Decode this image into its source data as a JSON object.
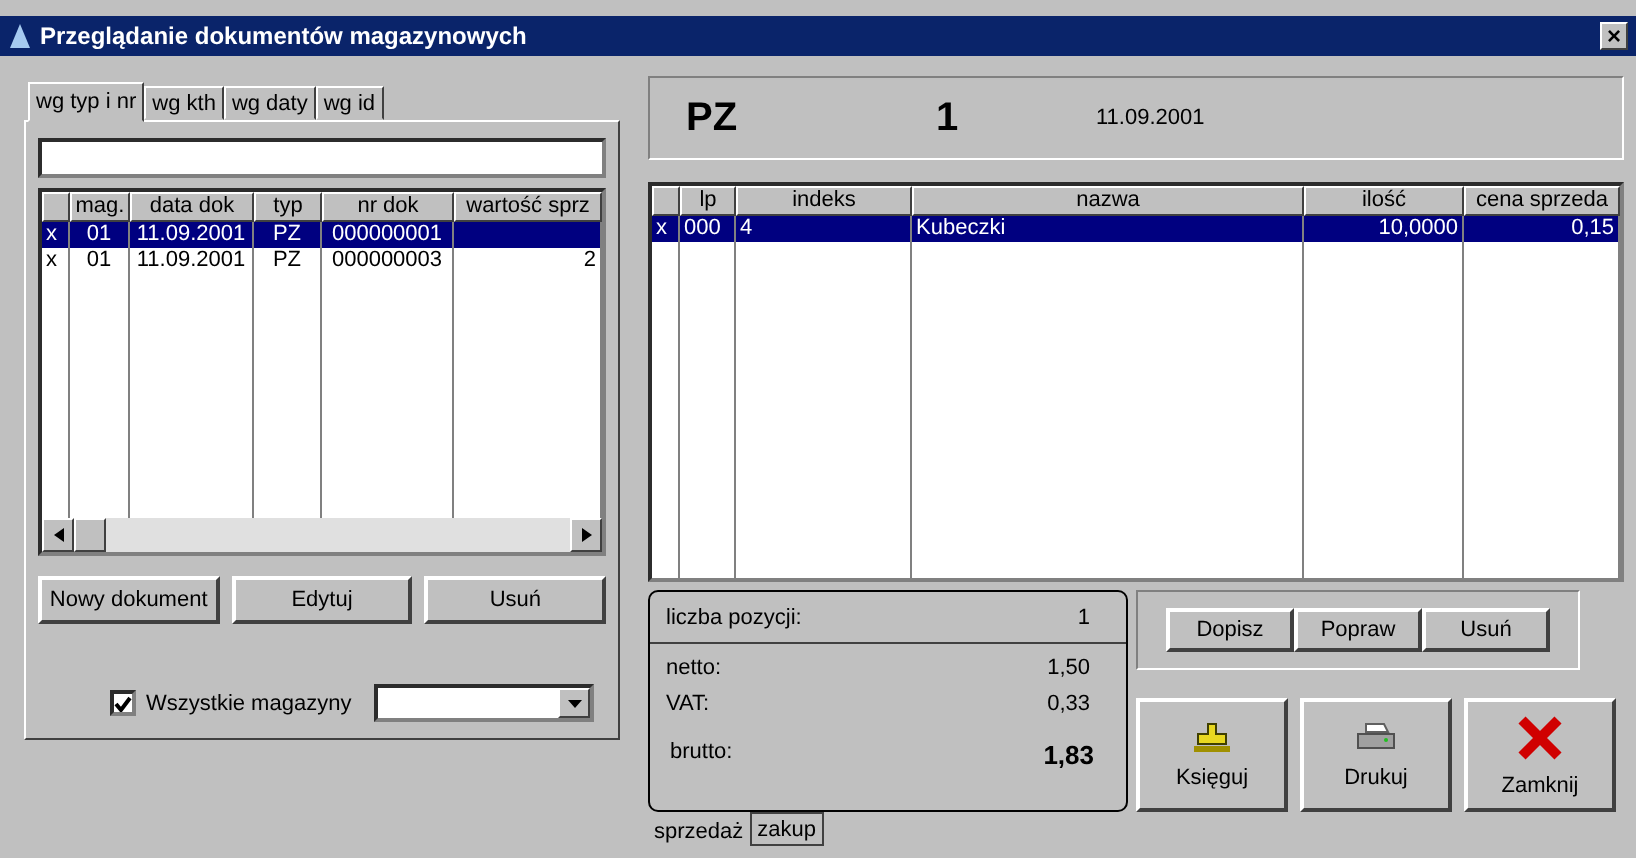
{
  "window": {
    "title": "Przeglądanie dokumentów magazynowych",
    "close": "×"
  },
  "left": {
    "tabs": [
      {
        "label": "wg typ i nr",
        "selected": true
      },
      {
        "label": "wg kth",
        "selected": false
      },
      {
        "label": "wg daty",
        "selected": false
      },
      {
        "label": "wg id",
        "selected": false
      }
    ],
    "table": {
      "columns": [
        "mag.",
        "data dok",
        "typ",
        "nr dok",
        "wartość sprz"
      ],
      "rows": [
        {
          "mark": "x",
          "cells": [
            "01",
            "11.09.2001",
            "PZ",
            "000000001",
            ""
          ],
          "selected": true
        },
        {
          "mark": "x",
          "cells": [
            "01",
            "11.09.2001",
            "PZ",
            "000000003",
            "2"
          ],
          "selected": false
        }
      ]
    },
    "buttons": [
      "Nowy dokument",
      "Edytuj",
      "Usuń"
    ],
    "all_warehouses": {
      "label": "Wszystkie magazyny",
      "checked": true
    }
  },
  "header": {
    "type": "PZ",
    "number": "1",
    "date": "11.09.2001"
  },
  "items": {
    "columns": [
      "lp",
      "indeks",
      "nazwa",
      "ilość",
      "cena sprzeda"
    ],
    "rows": [
      {
        "mark": "x",
        "cells": [
          "000",
          "4",
          "Kubeczki",
          "10,0000",
          "0,15"
        ],
        "selected": true
      }
    ]
  },
  "summary": {
    "count_label": "liczba pozycji:",
    "count": "1",
    "lines": [
      {
        "label": "netto:",
        "value": "1,50",
        "bold": false
      },
      {
        "label": "VAT:",
        "value": "0,33",
        "bold": false
      },
      {
        "label": "brutto:",
        "value": "1,83",
        "bold": true
      }
    ]
  },
  "item_buttons": [
    "Dopisz",
    "Popraw",
    "Usuń"
  ],
  "actions": [
    {
      "kind": "post",
      "label": "Księguj"
    },
    {
      "kind": "print",
      "label": "Drukuj"
    },
    {
      "kind": "close",
      "label": "Zamknij"
    }
  ],
  "bottom_tabs": [
    {
      "label": "sprzedaż",
      "selected": true
    },
    {
      "label": "zakup",
      "selected": false
    }
  ]
}
